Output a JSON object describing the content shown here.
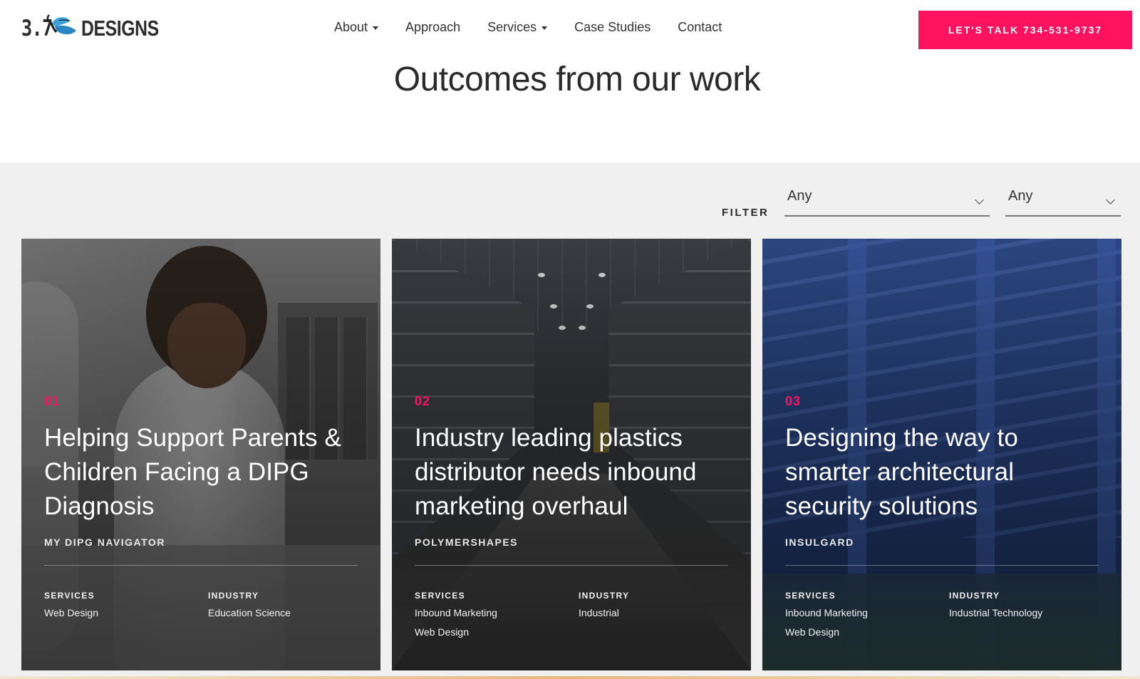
{
  "logo": {
    "part1": "3.7",
    "part2": "DESIGNS",
    "icon": "butterfly-icon"
  },
  "nav": {
    "items": [
      {
        "label": "About",
        "has_dropdown": true
      },
      {
        "label": "Approach",
        "has_dropdown": false
      },
      {
        "label": "Services",
        "has_dropdown": true
      },
      {
        "label": "Case Studies",
        "has_dropdown": false
      },
      {
        "label": "Contact",
        "has_dropdown": false
      }
    ]
  },
  "cta": {
    "label": "LET'S TALK 734-531-9737"
  },
  "page": {
    "title": "Outcomes from our work"
  },
  "filter": {
    "label": "FILTER",
    "select1": {
      "value": "Any"
    },
    "select2": {
      "value": "Any"
    }
  },
  "cards": [
    {
      "number": "01",
      "title": "Helping Support Parents & Children Facing a DIPG Diagnosis",
      "client": "MY DIPG NAVIGATOR",
      "services_label": "SERVICES",
      "services": [
        "Web Design"
      ],
      "industry_label": "INDUSTRY",
      "industry": "Education Science"
    },
    {
      "number": "02",
      "title": "Industry leading plastics distributor needs inbound marketing overhaul",
      "client": "POLYMERSHAPES",
      "services_label": "SERVICES",
      "services": [
        "Inbound Marketing",
        "Web Design"
      ],
      "industry_label": "INDUSTRY",
      "industry": "Industrial"
    },
    {
      "number": "03",
      "title": "Designing the way to smarter architectural security solutions",
      "client": "INSULGARD",
      "services_label": "SERVICES",
      "services": [
        "Inbound Marketing",
        "Web Design"
      ],
      "industry_label": "INDUSTRY",
      "industry": "Industrial Technology"
    }
  ],
  "colors": {
    "accent": "#ff1361",
    "section_bg": "#f0f0f0",
    "text": "#2a2a2a"
  }
}
